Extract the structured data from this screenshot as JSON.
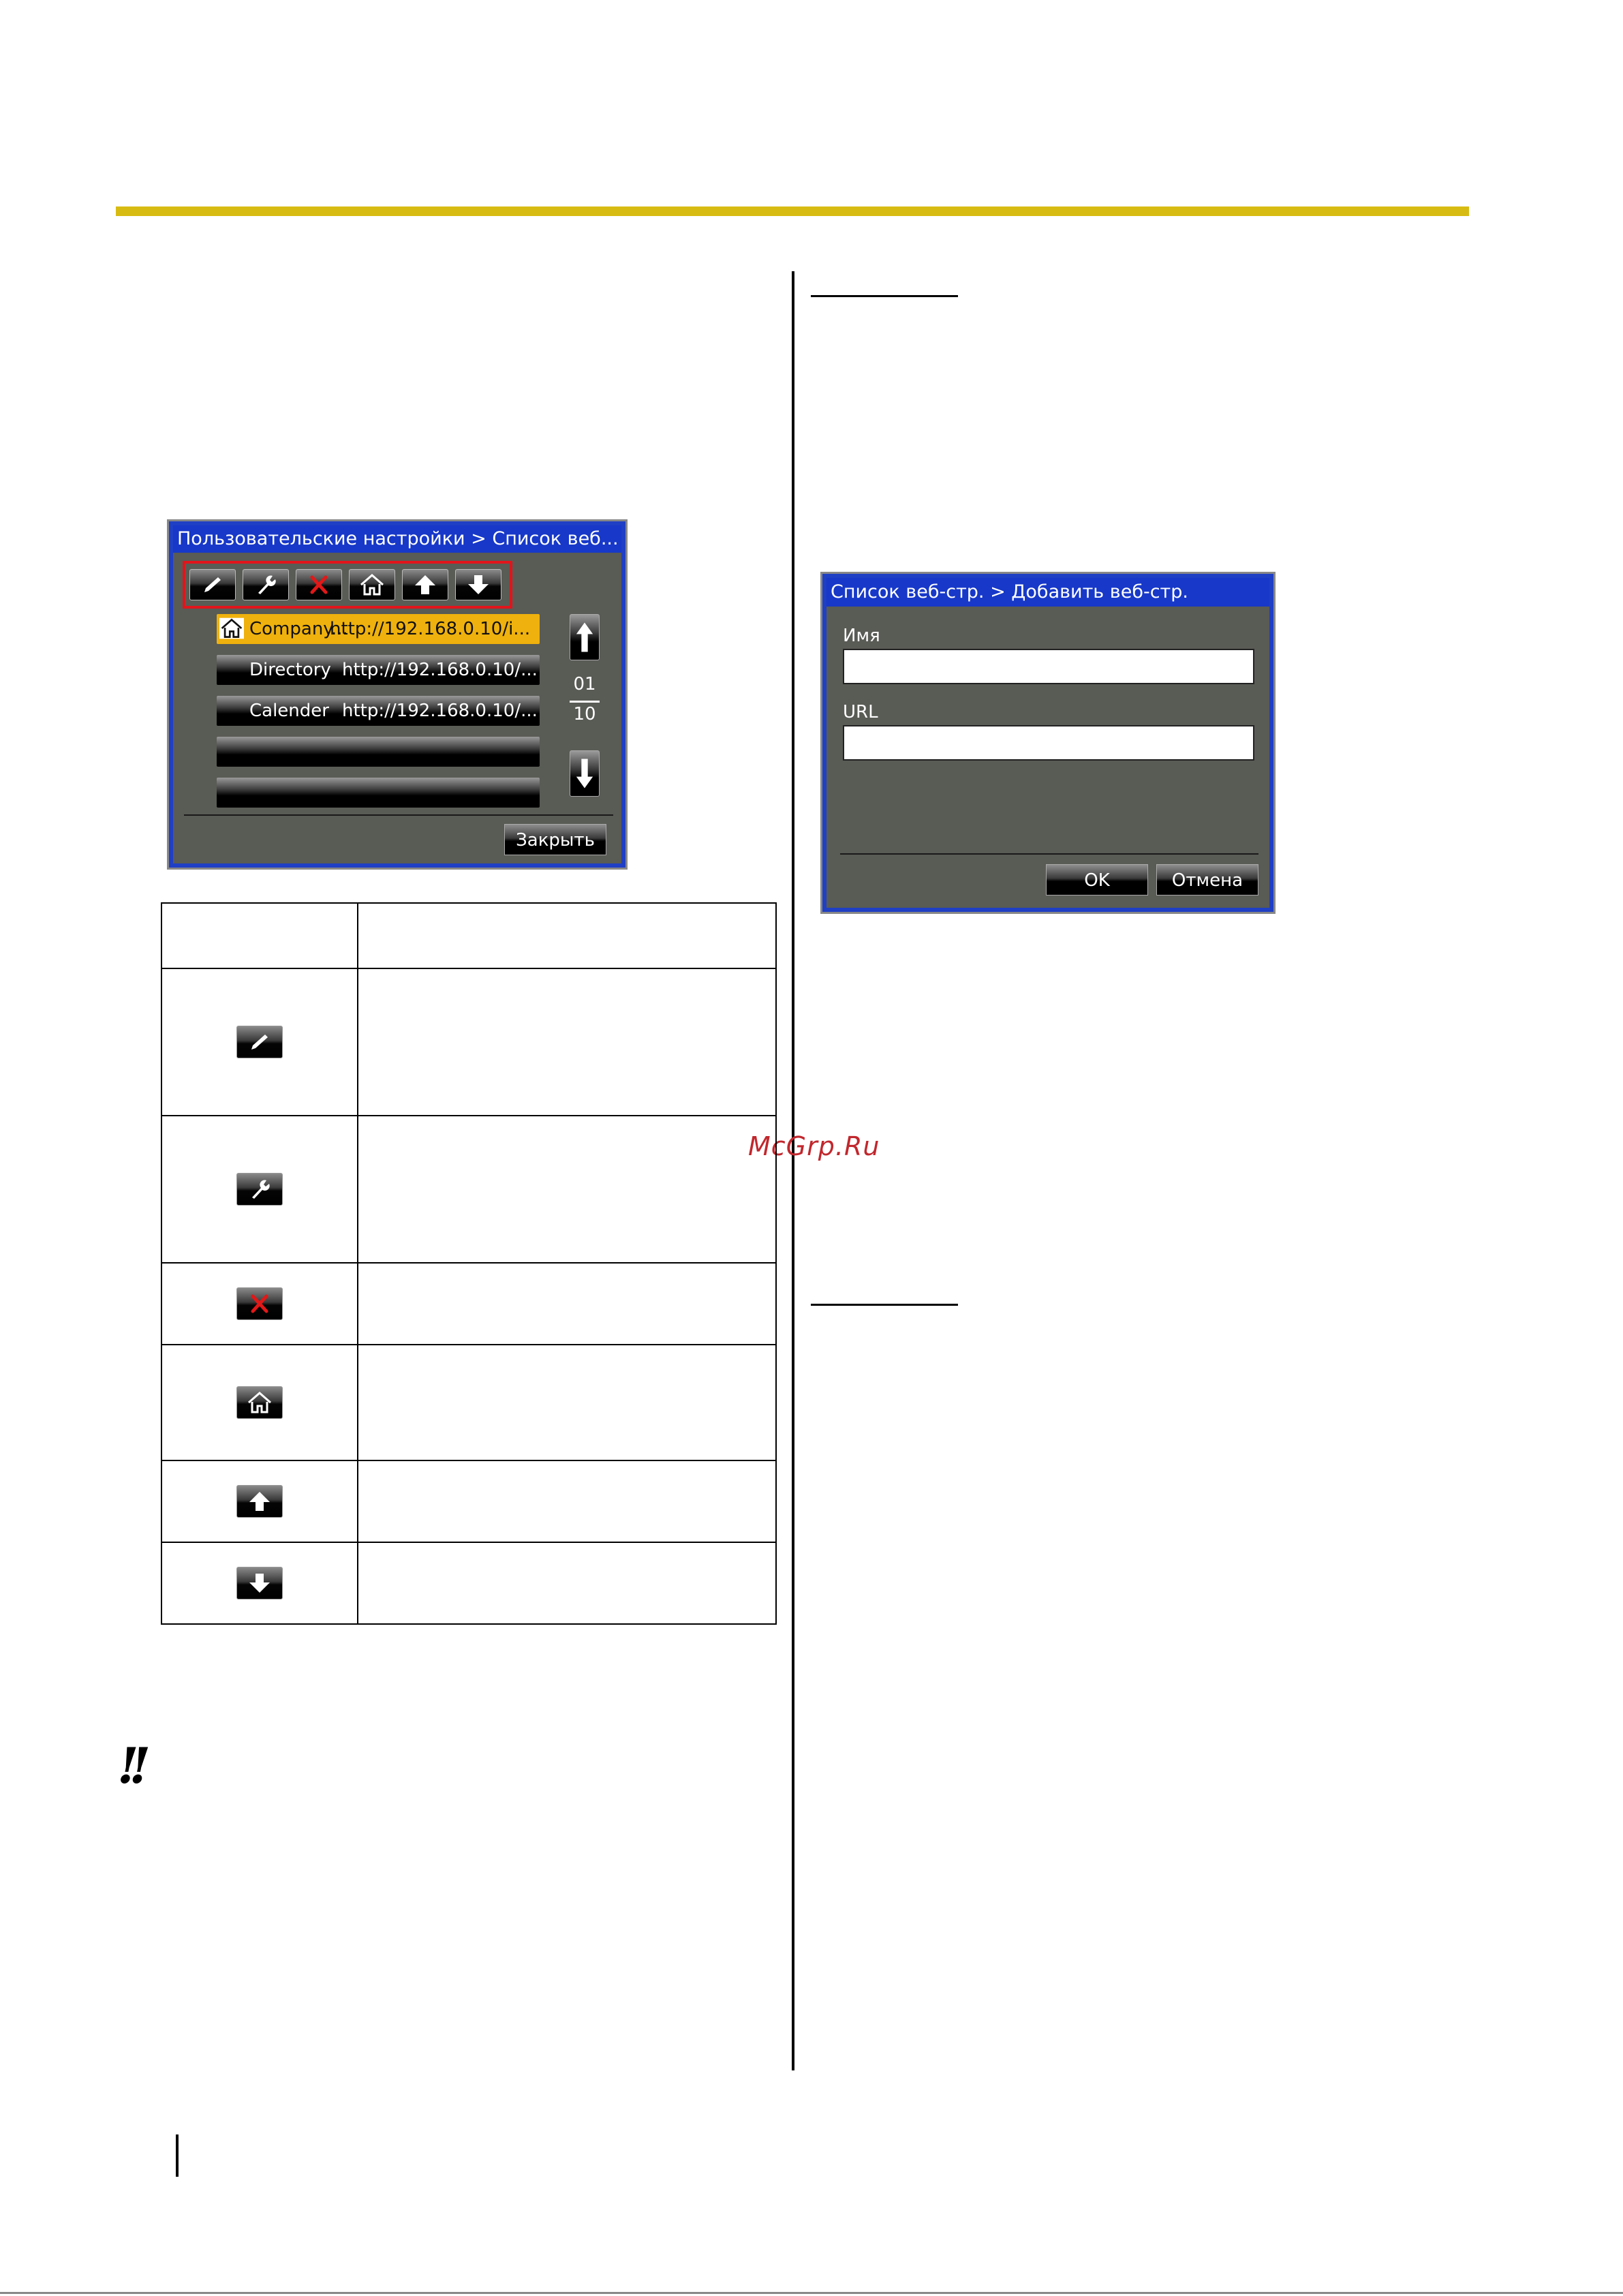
{
  "watermark": "McGrp.Ru",
  "warning_icon": "!!",
  "user_settings_screen": {
    "title": "Пользовательские настройки > Список веб...",
    "toolbar_icons": [
      "pencil-icon",
      "wrench-icon",
      "red-x-icon",
      "home-icon",
      "arrow-up-icon",
      "arrow-down-icon"
    ],
    "rows": [
      {
        "name": "Company...",
        "url": "http://192.168.0.10/i...",
        "selected": true,
        "home": true
      },
      {
        "name": "Directory",
        "url": "http://192.168.0.10/...",
        "selected": false,
        "home": false
      },
      {
        "name": "Calender",
        "url": "http://192.168.0.10/...",
        "selected": false,
        "home": false
      },
      {
        "name": "",
        "url": "",
        "selected": false,
        "home": false
      },
      {
        "name": "",
        "url": "",
        "selected": false,
        "home": false
      }
    ],
    "page_current": "01",
    "page_total": "10",
    "close_label": "Закрыть"
  },
  "add_page_dialog": {
    "title": "Список веб-стр. > Добавить веб-стр.",
    "name_label": "Имя",
    "name_value": "",
    "url_label": "URL",
    "url_value": "",
    "ok_label": "OK",
    "cancel_label": "Отмена"
  },
  "icon_table": {
    "header": [
      "",
      ""
    ],
    "rows": [
      {
        "icon": "pencil-icon",
        "desc": ""
      },
      {
        "icon": "wrench-icon",
        "desc": ""
      },
      {
        "icon": "red-x-icon",
        "desc": ""
      },
      {
        "icon": "home-icon",
        "desc": ""
      },
      {
        "icon": "arrow-up-icon",
        "desc": ""
      },
      {
        "icon": "arrow-down-icon",
        "desc": ""
      }
    ]
  },
  "colors": {
    "accent_rule": "#d8bb12",
    "screen_title_bg": "#1738c8",
    "screen_bg": "#595b55",
    "selected_row": "#efb10d",
    "highlight_frame": "#e2141b",
    "watermark": "#c1272d"
  }
}
